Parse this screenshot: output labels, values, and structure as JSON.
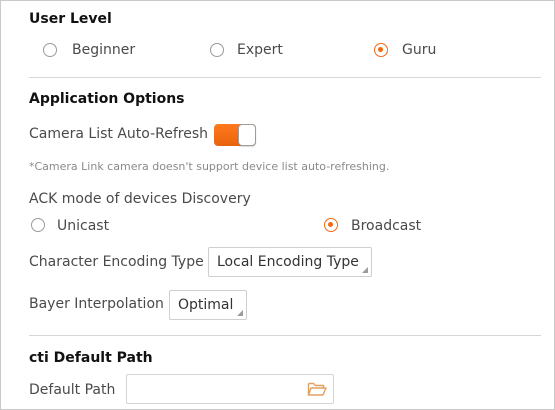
{
  "user_level": {
    "title": "User Level",
    "options": [
      {
        "label": "Beginner",
        "selected": false
      },
      {
        "label": "Expert",
        "selected": false
      },
      {
        "label": "Guru",
        "selected": true
      }
    ]
  },
  "application_options": {
    "title": "Application Options",
    "camera_list_auto_refresh": {
      "label": "Camera List Auto-Refresh",
      "enabled": true
    },
    "note": "*Camera Link camera doesn't support device list auto-refreshing.",
    "ack_mode": {
      "label": "ACK mode of devices Discovery",
      "options": [
        {
          "label": "Unicast",
          "selected": false
        },
        {
          "label": "Broadcast",
          "selected": true
        }
      ]
    },
    "character_encoding": {
      "label": "Character Encoding Type",
      "value": "Local Encoding Type"
    },
    "bayer_interpolation": {
      "label": "Bayer Interpolation",
      "value": "Optimal"
    }
  },
  "cti_default_path": {
    "title": "cti Default Path",
    "default_path": {
      "label": "Default Path",
      "value": "",
      "icon": "folder-open-icon"
    }
  },
  "colors": {
    "accent": "#f06a13",
    "divider": "#d6d6d6"
  }
}
